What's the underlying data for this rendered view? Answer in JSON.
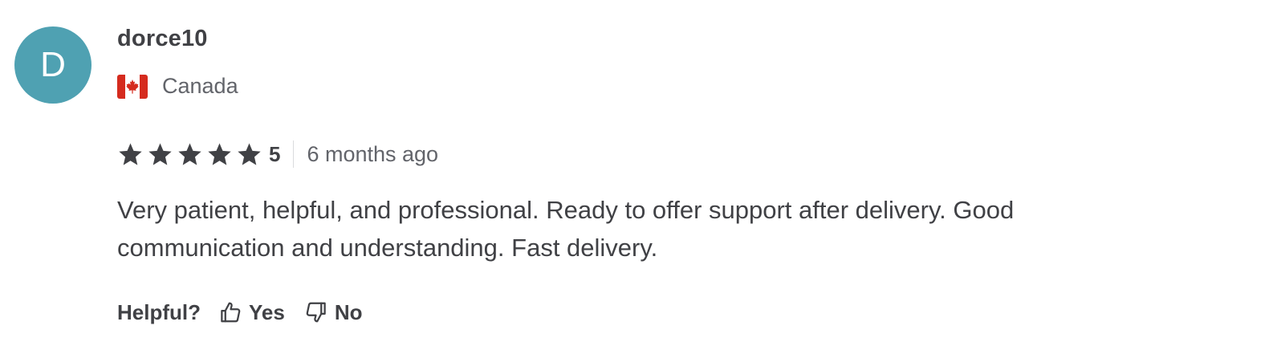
{
  "review": {
    "avatar_initial": "D",
    "username": "dorce10",
    "country": "Canada",
    "rating": "5",
    "time_ago": "6 months ago",
    "text": "Very patient, helpful, and professional. Ready to offer support after delivery. Good communication and understanding. Fast delivery.",
    "helpful_label": "Helpful?",
    "yes_label": "Yes",
    "no_label": "No"
  },
  "colors": {
    "avatar_bg": "#4fa1b2",
    "text_primary": "#404145",
    "text_secondary": "#62646a",
    "flag_red": "#d52b1e"
  },
  "icons": {
    "flag": "canada-flag-icon",
    "star": "star-icon",
    "thumbs_up": "thumbs-up-icon",
    "thumbs_down": "thumbs-down-icon"
  }
}
